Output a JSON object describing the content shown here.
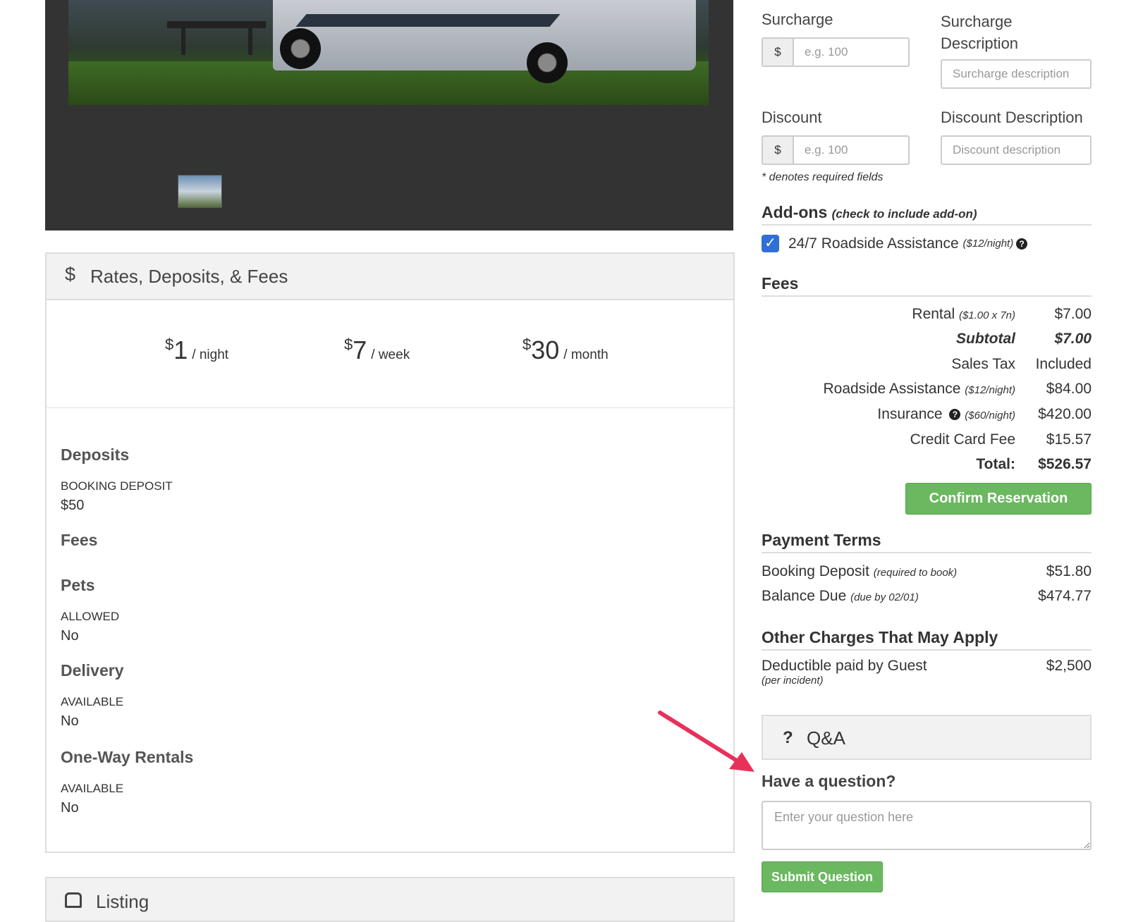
{
  "rates_panel": {
    "icon": "dollar-icon",
    "title": "Rates, Deposits, & Fees",
    "rates": [
      {
        "currency": "$",
        "amount": "1",
        "per": "/ night"
      },
      {
        "currency": "$",
        "amount": "7",
        "per": "/ week"
      },
      {
        "currency": "$",
        "amount": "30",
        "per": "/ month"
      }
    ],
    "deposits": {
      "heading": "Deposits",
      "label": "BOOKING DEPOSIT",
      "value": "$50"
    },
    "fees": {
      "heading": "Fees"
    },
    "pets": {
      "heading": "Pets",
      "label": "ALLOWED",
      "value": "No"
    },
    "delivery": {
      "heading": "Delivery",
      "label": "AVAILABLE",
      "value": "No"
    },
    "one_way": {
      "heading": "One-Way Rentals",
      "label": "AVAILABLE",
      "value": "No"
    }
  },
  "listing_panel": {
    "icon": "bus-icon",
    "title": "Listing"
  },
  "form": {
    "surcharge": {
      "label": "Surcharge",
      "addon": "$",
      "placeholder": "e.g. 100"
    },
    "surcharge_desc": {
      "label": "Surcharge Description",
      "placeholder": "Surcharge description"
    },
    "discount": {
      "label": "Discount",
      "addon": "$",
      "placeholder": "e.g. 100"
    },
    "discount_desc": {
      "label": "Discount Description",
      "placeholder": "Discount description"
    },
    "required_note": "* denotes required fields"
  },
  "addons": {
    "title": "Add-ons",
    "subtitle": "(check to include add-on)",
    "items": [
      {
        "label": "24/7 Roadside Assistance",
        "rate": "($12/night)",
        "checked": true
      }
    ]
  },
  "fees": {
    "title": "Fees",
    "rows": [
      {
        "label": "Rental",
        "note": "($1.00 x 7n)",
        "value": "$7.00"
      },
      {
        "label": "Subtotal",
        "note": "",
        "value": "$7.00"
      },
      {
        "label": "Sales Tax",
        "note": "",
        "value": "Included"
      },
      {
        "label": "Roadside Assistance",
        "note": "($12/night)",
        "value": "$84.00"
      },
      {
        "label": "Insurance",
        "note": "($60/night)",
        "value": "$420.00"
      },
      {
        "label": "Credit Card Fee",
        "note": "",
        "value": "$15.57"
      },
      {
        "label": "Total:",
        "note": "",
        "value": "$526.57"
      }
    ],
    "confirm_button": "Confirm Reservation"
  },
  "payment_terms": {
    "title": "Payment Terms",
    "rows": [
      {
        "label": "Booking Deposit",
        "note": "(required to book)",
        "value": "$51.80"
      },
      {
        "label": "Balance Due",
        "note": "(due by 02/01)",
        "value": "$474.77"
      }
    ]
  },
  "other_charges": {
    "title": "Other Charges That May Apply",
    "rows": [
      {
        "label": "Deductible paid by Guest",
        "note": "(per incident)",
        "value": "$2,500"
      }
    ]
  },
  "qa": {
    "icon": "question-icon",
    "icon_glyph": "?",
    "title": "Q&A",
    "heading": "Have a question?",
    "placeholder": "Enter your question here",
    "submit": "Submit Question"
  },
  "colors": {
    "accent_green": "#6ab85f",
    "checkbox_blue": "#2f6fd6",
    "annotation_arrow": "#e8315a"
  }
}
